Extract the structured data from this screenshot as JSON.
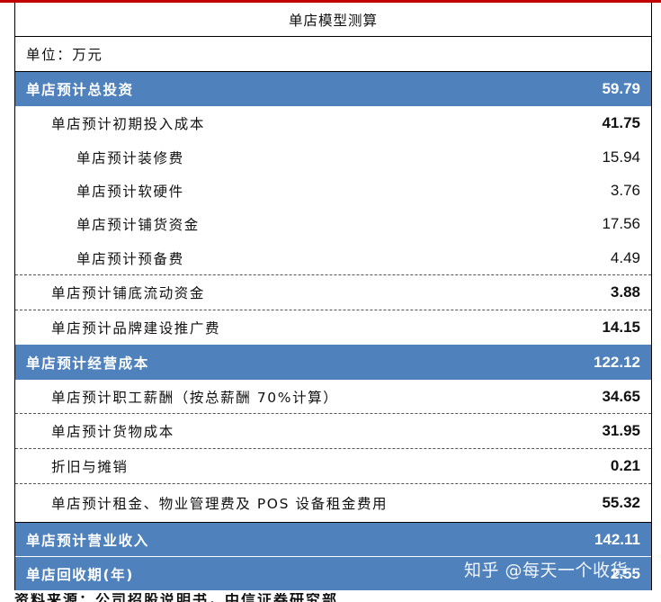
{
  "title": "单店模型测算",
  "unit": "单位：万元",
  "rows": [
    {
      "label": "单店预计总投资",
      "value": "59.79"
    },
    {
      "label": "单店预计初期投入成本",
      "value": "41.75"
    },
    {
      "label": "单店预计装修费",
      "value": "15.94"
    },
    {
      "label": "单店预计软硬件",
      "value": "3.76"
    },
    {
      "label": "单店预计铺货资金",
      "value": "17.56"
    },
    {
      "label": "单店预计预备费",
      "value": "4.49"
    },
    {
      "label": "单店预计铺底流动资金",
      "value": "3.88"
    },
    {
      "label": "单店预计品牌建设推广费",
      "value": "14.15"
    },
    {
      "label": "单店预计经营成本",
      "value": "122.12"
    },
    {
      "label": "单店预计职工薪酬（按总薪酬 70%计算）",
      "value": "34.65"
    },
    {
      "label": "单店预计货物成本",
      "value": "31.95"
    },
    {
      "label": "折旧与摊销",
      "value": "0.21"
    },
    {
      "label": "单店预计租金、物业管理费及 POS 设备租金费用",
      "value": "55.32"
    },
    {
      "label": "单店预计营业收入",
      "value": "142.11"
    },
    {
      "label": "单店回收期(年)",
      "value": "2.55"
    }
  ],
  "watermark": "知乎 @每天一个收货",
  "footnote": "资料来源：公司招股说明书，中信证券研究部"
}
